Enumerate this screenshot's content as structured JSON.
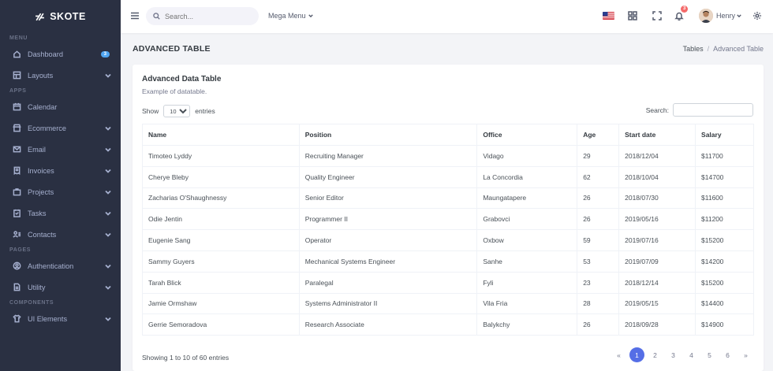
{
  "brand": {
    "name": "SKOTE"
  },
  "sidebar": {
    "sections": [
      {
        "title": "MENU",
        "items": [
          {
            "label": "Dashboard",
            "icon": "home-icon",
            "badge": "3",
            "chevron": false
          },
          {
            "label": "Layouts",
            "icon": "layout-icon",
            "chevron": true
          }
        ]
      },
      {
        "title": "APPS",
        "items": [
          {
            "label": "Calendar",
            "icon": "calendar-icon",
            "chevron": false
          },
          {
            "label": "Ecommerce",
            "icon": "store-icon",
            "chevron": true
          },
          {
            "label": "Email",
            "icon": "envelope-icon",
            "chevron": true
          },
          {
            "label": "Invoices",
            "icon": "receipt-icon",
            "chevron": true
          },
          {
            "label": "Projects",
            "icon": "briefcase-icon",
            "chevron": true
          },
          {
            "label": "Tasks",
            "icon": "task-icon",
            "chevron": true
          },
          {
            "label": "Contacts",
            "icon": "contacts-icon",
            "chevron": true
          }
        ]
      },
      {
        "title": "PAGES",
        "items": [
          {
            "label": "Authentication",
            "icon": "user-circle-icon",
            "chevron": true
          },
          {
            "label": "Utility",
            "icon": "file-icon",
            "chevron": true
          }
        ]
      },
      {
        "title": "COMPONENTS",
        "items": [
          {
            "label": "UI Elements",
            "icon": "tshirt-icon",
            "chevron": true
          }
        ]
      }
    ]
  },
  "topbar": {
    "search_placeholder": "Search...",
    "mega_menu": "Mega Menu",
    "notification_count": "3",
    "user_name": "Henry"
  },
  "page": {
    "title": "ADVANCED TABLE",
    "breadcrumb": [
      "Tables",
      "Advanced Table"
    ]
  },
  "card": {
    "title": "Advanced Data Table",
    "subtitle": "Example of datatable.",
    "show_label": "Show",
    "entries_value": "10",
    "entries_label": "entries",
    "search_label": "Search:"
  },
  "table": {
    "columns": [
      "Name",
      "Position",
      "Office",
      "Age",
      "Start date",
      "Salary"
    ],
    "rows": [
      [
        "Timoteo Lyddy",
        "Recruiting Manager",
        "Vidago",
        "29",
        "2018/12/04",
        "$11700"
      ],
      [
        "Cherye Bleby",
        "Quality Engineer",
        "La Concordia",
        "62",
        "2018/10/04",
        "$14700"
      ],
      [
        "Zacharias O'Shaughnessy",
        "Senior Editor",
        "Maungatapere",
        "26",
        "2018/07/30",
        "$11600"
      ],
      [
        "Odie Jentin",
        "Programmer II",
        "Grabovci",
        "26",
        "2019/05/16",
        "$11200"
      ],
      [
        "Eugenie Sang",
        "Operator",
        "Oxbow",
        "59",
        "2019/07/16",
        "$15200"
      ],
      [
        "Sammy Guyers",
        "Mechanical Systems Engineer",
        "Sanhe",
        "53",
        "2019/07/09",
        "$14200"
      ],
      [
        "Tarah Blick",
        "Paralegal",
        "Fyli",
        "23",
        "2018/12/14",
        "$15200"
      ],
      [
        "Jamie Ormshaw",
        "Systems Administrator II",
        "Vila Fria",
        "28",
        "2019/05/15",
        "$14400"
      ],
      [
        "Gerrie Semoradova",
        "Research Associate",
        "Balykchy",
        "26",
        "2018/09/28",
        "$14900"
      ]
    ]
  },
  "footer": {
    "info": "Showing 1 to 10 of 60 entries",
    "pages": [
      "1",
      "2",
      "3",
      "4",
      "5",
      "6"
    ],
    "prev": "«",
    "next": "»",
    "active_page": "1"
  },
  "colors": {
    "sidebar_bg": "#2a3042",
    "accent": "#556ee6",
    "badge": "#f46a6a"
  }
}
